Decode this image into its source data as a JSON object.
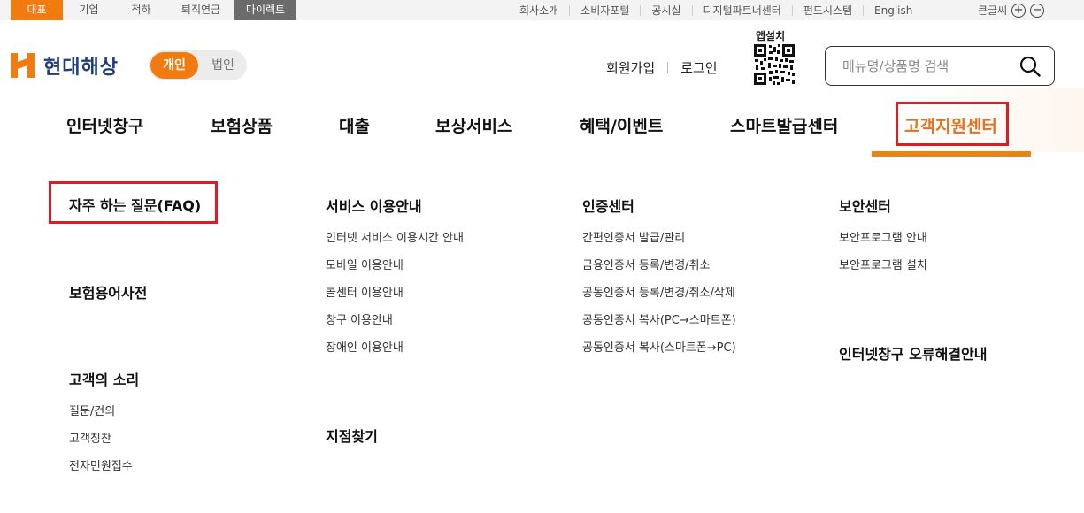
{
  "topbar": {
    "tabs": [
      "대표",
      "기업",
      "적하",
      "퇴직연금",
      "다이렉트"
    ],
    "links": [
      "회사소개",
      "소비자포털",
      "공시실",
      "디지털파트너센터",
      "펀드시스템",
      "English"
    ],
    "font_size_label": "큰글씨",
    "font_plus": "+",
    "font_minus": "−"
  },
  "header": {
    "brand": "현대해상",
    "switch_on": "개인",
    "switch_off": "법인",
    "join": "회원가입",
    "login": "로그인",
    "app_install": "앱설치",
    "search_placeholder": "메뉴명/상품명 검색"
  },
  "gnb": {
    "items": [
      "인터넷창구",
      "보험상품",
      "대출",
      "보상서비스",
      "혜택/이벤트",
      "스마트발급센터",
      "고객지원센터"
    ]
  },
  "menu": {
    "col1": {
      "faq": "자주 하는 질문(FAQ)",
      "dictionary": "보험용어사전",
      "voice": "고객의 소리",
      "voice_items": [
        "질문/건의",
        "고객칭찬",
        "전자민원접수"
      ]
    },
    "col2": {
      "service": "서비스 이용안내",
      "service_items": [
        "인터넷 서비스 이용시간 안내",
        "모바일 이용안내",
        "콜센터 이용안내",
        "창구 이용안내",
        "장애인 이용안내"
      ],
      "branch": "지점찾기"
    },
    "col3": {
      "cert": "인증센터",
      "cert_items": [
        "간편인증서 발급/관리",
        "금융인증서 등록/변경/취소",
        "공동인증서 등록/변경/취소/삭제",
        "공동인증서 복사(PC→스마트폰)",
        "공동인증서 복사(스마트폰→PC)"
      ]
    },
    "col4": {
      "security": "보안센터",
      "security_items": [
        "보안프로그램 안내",
        "보안프로그램 설치"
      ],
      "error": "인터넷창구 오류해결안내"
    }
  },
  "colors": {
    "accent": "#f27b10",
    "highlight_red": "#e01b24",
    "brand_navy": "#1f3f7a"
  }
}
